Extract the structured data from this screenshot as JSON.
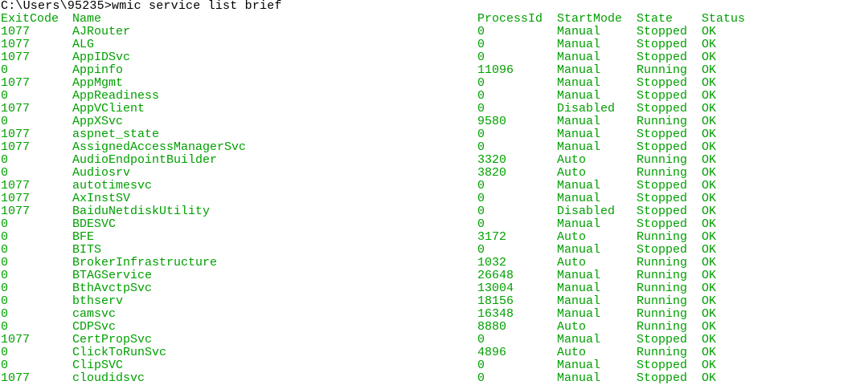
{
  "terminal": {
    "prompt": "C:\\Users\\95235>wmic service list brief",
    "columns": [
      "ExitCode",
      "Name",
      "ProcessId",
      "StartMode",
      "State",
      "Status"
    ],
    "rows": [
      [
        "1077",
        "AJRouter",
        "0",
        "Manual",
        "Stopped",
        "OK"
      ],
      [
        "1077",
        "ALG",
        "0",
        "Manual",
        "Stopped",
        "OK"
      ],
      [
        "1077",
        "AppIDSvc",
        "0",
        "Manual",
        "Stopped",
        "OK"
      ],
      [
        "0",
        "Appinfo",
        "11096",
        "Manual",
        "Running",
        "OK"
      ],
      [
        "1077",
        "AppMgmt",
        "0",
        "Manual",
        "Stopped",
        "OK"
      ],
      [
        "0",
        "AppReadiness",
        "0",
        "Manual",
        "Stopped",
        "OK"
      ],
      [
        "1077",
        "AppVClient",
        "0",
        "Disabled",
        "Stopped",
        "OK"
      ],
      [
        "0",
        "AppXSvc",
        "9580",
        "Manual",
        "Running",
        "OK"
      ],
      [
        "1077",
        "aspnet_state",
        "0",
        "Manual",
        "Stopped",
        "OK"
      ],
      [
        "1077",
        "AssignedAccessManagerSvc",
        "0",
        "Manual",
        "Stopped",
        "OK"
      ],
      [
        "0",
        "AudioEndpointBuilder",
        "3320",
        "Auto",
        "Running",
        "OK"
      ],
      [
        "0",
        "Audiosrv",
        "3820",
        "Auto",
        "Running",
        "OK"
      ],
      [
        "1077",
        "autotimesvc",
        "0",
        "Manual",
        "Stopped",
        "OK"
      ],
      [
        "1077",
        "AxInstSV",
        "0",
        "Manual",
        "Stopped",
        "OK"
      ],
      [
        "1077",
        "BaiduNetdiskUtility",
        "0",
        "Disabled",
        "Stopped",
        "OK"
      ],
      [
        "0",
        "BDESVC",
        "0",
        "Manual",
        "Stopped",
        "OK"
      ],
      [
        "0",
        "BFE",
        "3172",
        "Auto",
        "Running",
        "OK"
      ],
      [
        "0",
        "BITS",
        "0",
        "Manual",
        "Stopped",
        "OK"
      ],
      [
        "0",
        "BrokerInfrastructure",
        "1032",
        "Auto",
        "Running",
        "OK"
      ],
      [
        "0",
        "BTAGService",
        "26648",
        "Manual",
        "Running",
        "OK"
      ],
      [
        "0",
        "BthAvctpSvc",
        "13004",
        "Manual",
        "Running",
        "OK"
      ],
      [
        "0",
        "bthserv",
        "18156",
        "Manual",
        "Running",
        "OK"
      ],
      [
        "0",
        "camsvc",
        "16348",
        "Manual",
        "Running",
        "OK"
      ],
      [
        "0",
        "CDPSvc",
        "8880",
        "Auto",
        "Running",
        "OK"
      ],
      [
        "1077",
        "CertPropSvc",
        "0",
        "Manual",
        "Stopped",
        "OK"
      ],
      [
        "0",
        "ClickToRunSvc",
        "4896",
        "Auto",
        "Running",
        "OK"
      ],
      [
        "0",
        "ClipSVC",
        "0",
        "Manual",
        "Stopped",
        "OK"
      ],
      [
        "1077",
        "cloudidsvc",
        "0",
        "Manual",
        "Stopped",
        "OK"
      ]
    ]
  },
  "colors": {
    "background": "#ffffff",
    "prompt_text": "#000000",
    "output_text": "#00a000"
  }
}
